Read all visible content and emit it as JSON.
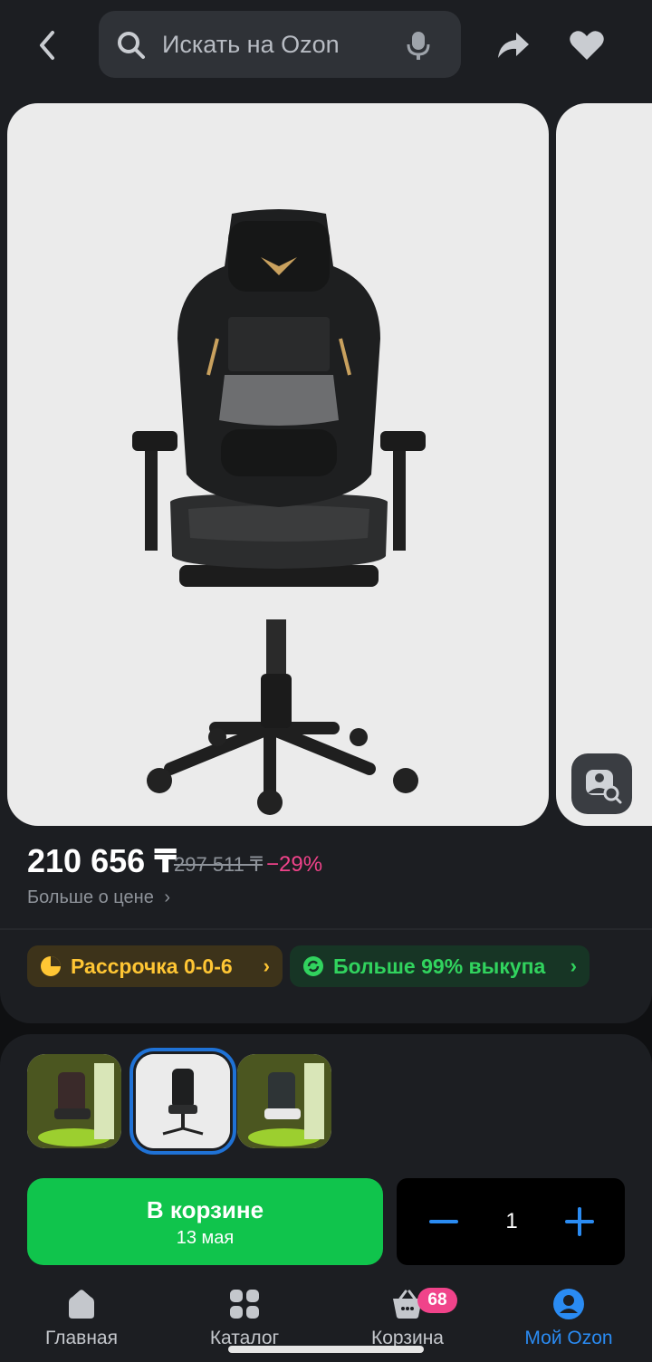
{
  "header": {
    "search_placeholder": "Искать на Ozon",
    "back_icon": "chevron-left-icon",
    "search_icon": "search-icon",
    "mic_icon": "microphone-icon",
    "share_icon": "share-icon",
    "favorite_icon": "heart-icon"
  },
  "product": {
    "price": "210 656 ₸",
    "old_price": "297 511 ₸",
    "discount": "−29%",
    "more_about_price": "Больше о цене",
    "visual_search_icon": "image-search-icon"
  },
  "badges": {
    "installment": "Рассрочка 0-0-6",
    "buyout": "Больше 99% выкупа"
  },
  "thumbnails": {
    "selected_index": 1,
    "count": 3
  },
  "cart": {
    "button_label": "В корзине",
    "delivery_date": "13 мая",
    "quantity": "1"
  },
  "nav": {
    "home": "Главная",
    "catalog": "Каталог",
    "cart": "Корзина",
    "cart_count": "68",
    "my_ozon": "Мой Ozon"
  },
  "colors": {
    "accent_green": "#10c44c",
    "accent_blue": "#2a8bf2",
    "discount_pink": "#f0438a",
    "installment_yellow": "#ffc634"
  }
}
